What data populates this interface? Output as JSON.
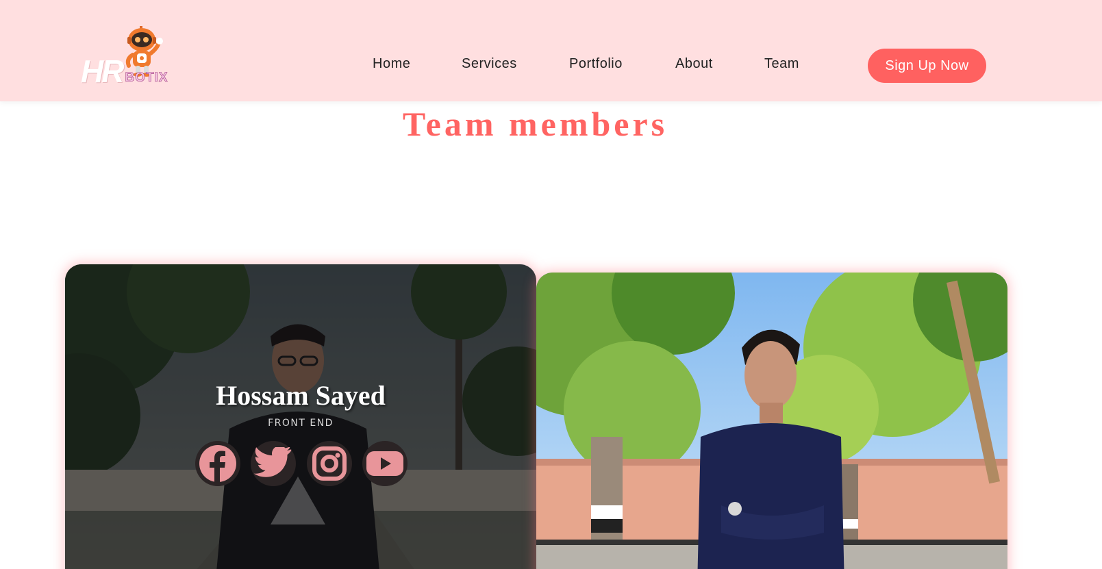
{
  "header": {
    "logo_text_main": "HR",
    "logo_text_sub": "BOTIX",
    "nav": [
      {
        "label": "Home"
      },
      {
        "label": "Services"
      },
      {
        "label": "Portfolio"
      },
      {
        "label": "About"
      },
      {
        "label": "Team"
      }
    ],
    "cta_label": "Sign Up Now"
  },
  "main": {
    "title": "Team members",
    "members": [
      {
        "name": "Hossam Sayed",
        "role": "FRONT END",
        "socials": [
          "facebook-icon",
          "twitter-icon",
          "instagram-icon",
          "youtube-icon"
        ]
      }
    ]
  },
  "colors": {
    "header_bg": "#ffdfe0",
    "accent": "#ff6160",
    "social_icon": "#e8959a"
  }
}
